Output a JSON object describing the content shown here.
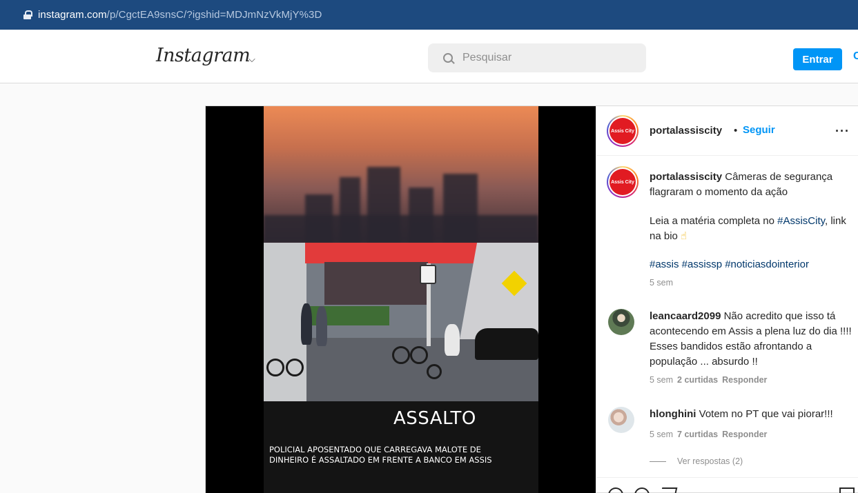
{
  "browser": {
    "url_host": "instagram.com",
    "url_path": "/p/CgctEA9snsC/?igshid=MDJmNzVkMjY%3D"
  },
  "header": {
    "logo_text": "Instagram",
    "logo_chevron": "⌵",
    "search_placeholder": "Pesquisar",
    "login_label": "Entrar",
    "cutoff_link": "C"
  },
  "post": {
    "video": {
      "overlay_title": "ASSALTO",
      "overlay_caption": "POLICIAL APOSENTADO QUE CARREGAVA MALOTE DE DINHEIRO É ASSALTADO EM FRENTE A BANCO EM ASSIS"
    },
    "author": {
      "username": "portalassiscity",
      "separator": "•",
      "follow_label": "Seguir",
      "more_label": "···",
      "avatar_text": "Assis City"
    },
    "caption": {
      "username": "portalassiscity",
      "line1": "Câmeras de segurança flagraram o momento da ação",
      "line2_prefix": "Leia a matéria completa no ",
      "line2_tag": "#AssisCity",
      "line2_suffix": ", link na bio",
      "line2_emoji": "☝",
      "hashtags": "#assis #assissp #noticiasdointerior",
      "age": "5 sem"
    },
    "comments": [
      {
        "username": "leancaard2099",
        "text": "Não acredito que isso tá acontecendo em Assis a plena luz do dia !!!! Esses bandidos estão afrontando a população ... absurdo !!",
        "age": "5 sem",
        "likes": "2 curtidas",
        "reply_label": "Responder"
      },
      {
        "username": "hlonghini",
        "text": "Votem no PT que vai piorar!!!",
        "age": "5 sem",
        "likes": "7 curtidas",
        "reply_label": "Responder"
      }
    ],
    "view_replies": "Ver respostas (2)"
  },
  "colors": {
    "url_bar": "#1d4a7f",
    "accent_blue": "#0095f6",
    "hashtag": "#00376b",
    "muted": "#8e8e8e"
  }
}
